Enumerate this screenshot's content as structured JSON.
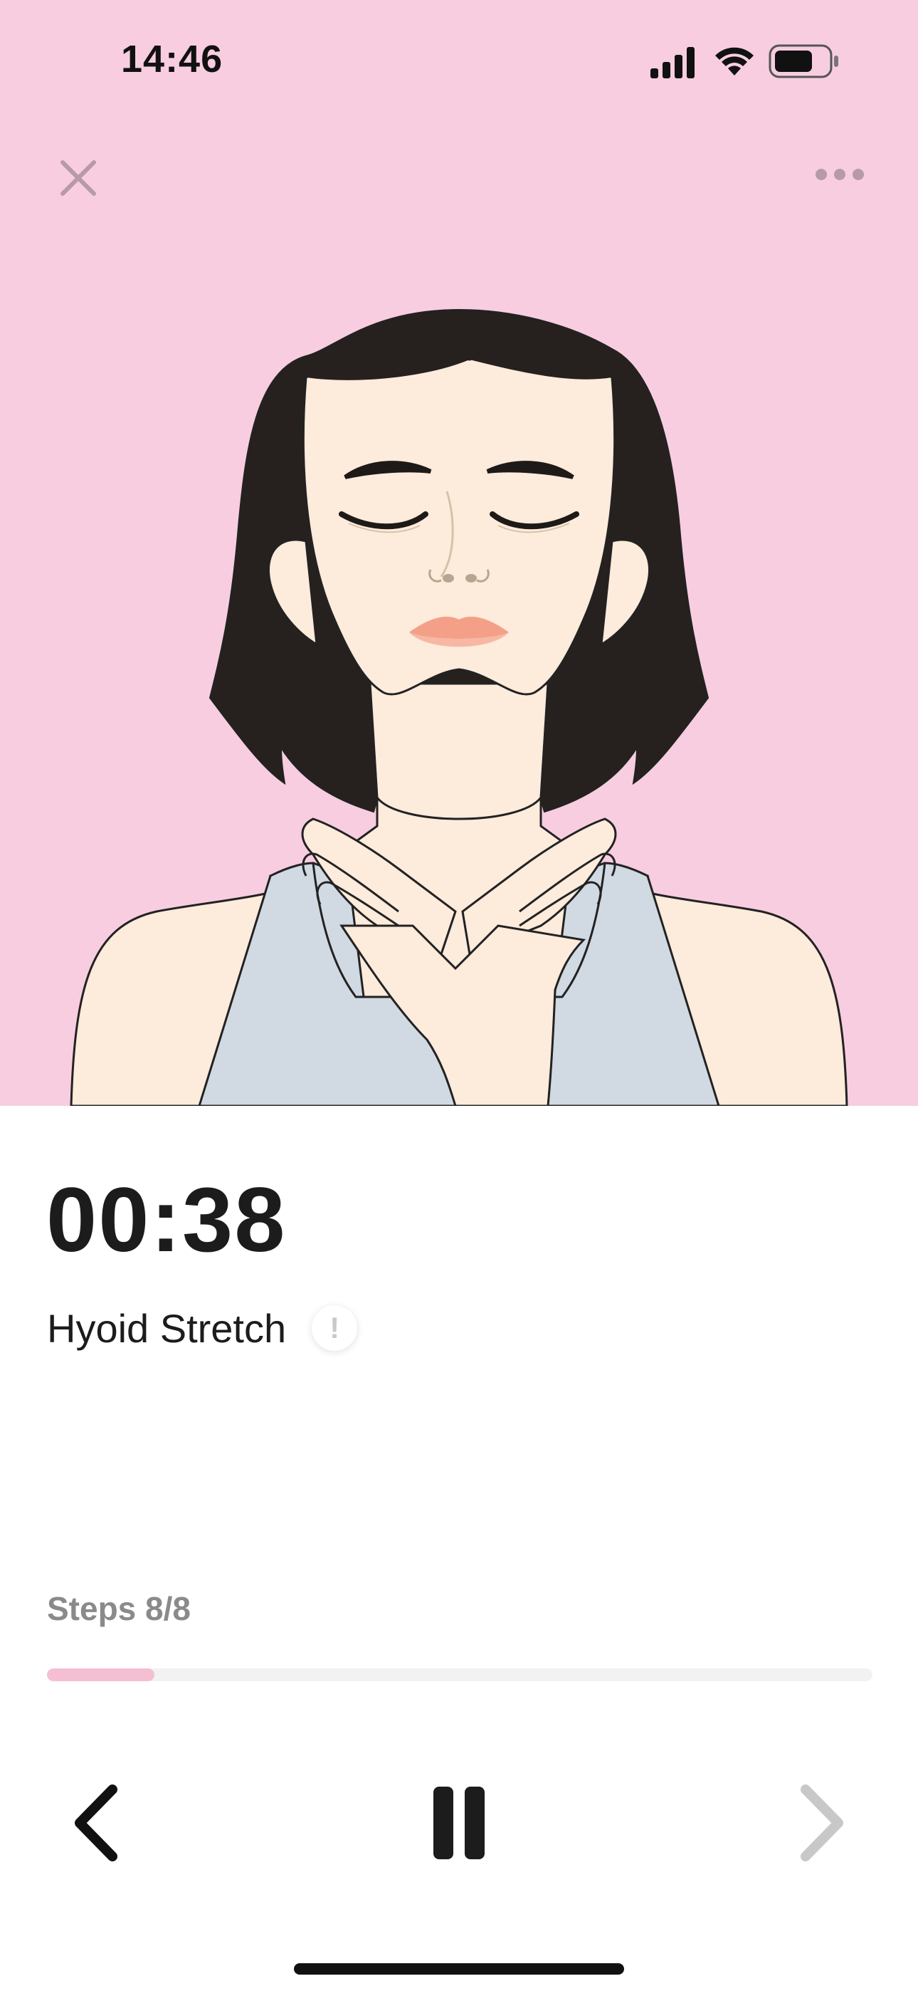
{
  "status_bar": {
    "time": "14:46",
    "icons": [
      "signal-icon",
      "wifi-icon",
      "battery-icon"
    ]
  },
  "header": {
    "close_icon": "close-icon",
    "more_icon": "more-icon"
  },
  "illustration": {
    "icon": "woman-hyoid-stretch-illustration"
  },
  "exercise": {
    "timer": "00:38",
    "name": "Hyoid Stretch",
    "info_icon": "info-icon",
    "info_glyph": "!"
  },
  "progress": {
    "steps_label": "Steps 8/8",
    "fraction": 0.13
  },
  "controls": {
    "prev_icon": "chevron-left-icon",
    "pause_icon": "pause-icon",
    "next_icon": "chevron-right-icon"
  },
  "colors": {
    "hero_background": "#f8cde0",
    "progress_fill": "#f4bfd3",
    "progress_track": "#f2f2f2",
    "text_primary": "#1c1c1c",
    "text_secondary": "#8a8a8a"
  }
}
